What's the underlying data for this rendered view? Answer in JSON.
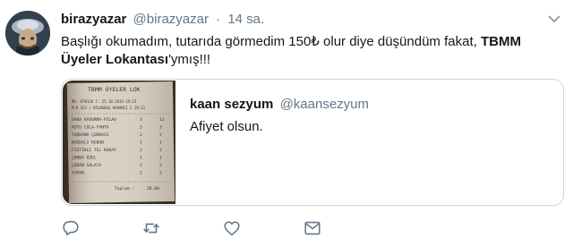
{
  "tweet": {
    "display_name": "birazyazar",
    "handle": "@birazyazar",
    "separator": "·",
    "time": "14 sa.",
    "text_plain": "Başlığı okumadım, tutarıda görmedim 150₺ olur diye düşündüm fakat, ",
    "text_bold": "TBMM Üyeler Lokantası",
    "text_suffix": "'ymış!!!"
  },
  "quoted_tweet": {
    "display_name": "kaan sezyum",
    "handle": "@kaansezyum",
    "text": "Afiyet olsun.",
    "receipt": {
      "header": "TBMM ÜYELER LOK",
      "line1": "ÖK: #78138   T: 25.10.2019-19:23",
      "line2": "M:8 CE2 / BİLNGBAŞ KARANCI  2  19:33",
      "items": [
        {
          "name": "DANA KAVURMA-PİLAV",
          "qty": "3",
          "price": "13"
        },
        {
          "name": "KUTU COLA-FANTA",
          "qty": "3",
          "price": "3"
        },
        {
          "name": "TARHANA ÇORBASI",
          "qty": "2",
          "price": "2"
        },
        {
          "name": "BAĞDALI KEBAB",
          "qty": "1",
          "price": "1"
        },
        {
          "name": "FISTIKLI TEL KADAY",
          "qty": "3",
          "price": "3"
        },
        {
          "name": "ÇORBA ÖZEL",
          "qty": "1",
          "price": "1"
        },
        {
          "name": "ÇOBAN SALATA",
          "qty": "2",
          "price": "2"
        },
        {
          "name": "AYRAN",
          "qty": "2",
          "price": "2"
        }
      ],
      "total_label": "Toplam :",
      "total_value": "28,00"
    }
  },
  "actions": {
    "reply_icon": "reply-icon",
    "retweet_icon": "retweet-icon",
    "like_icon": "like-icon",
    "dm_icon": "direct-message-icon"
  },
  "colors": {
    "text": "#14171a",
    "secondary": "#657786",
    "border": "#ccd6dd",
    "icon": "#657786"
  }
}
